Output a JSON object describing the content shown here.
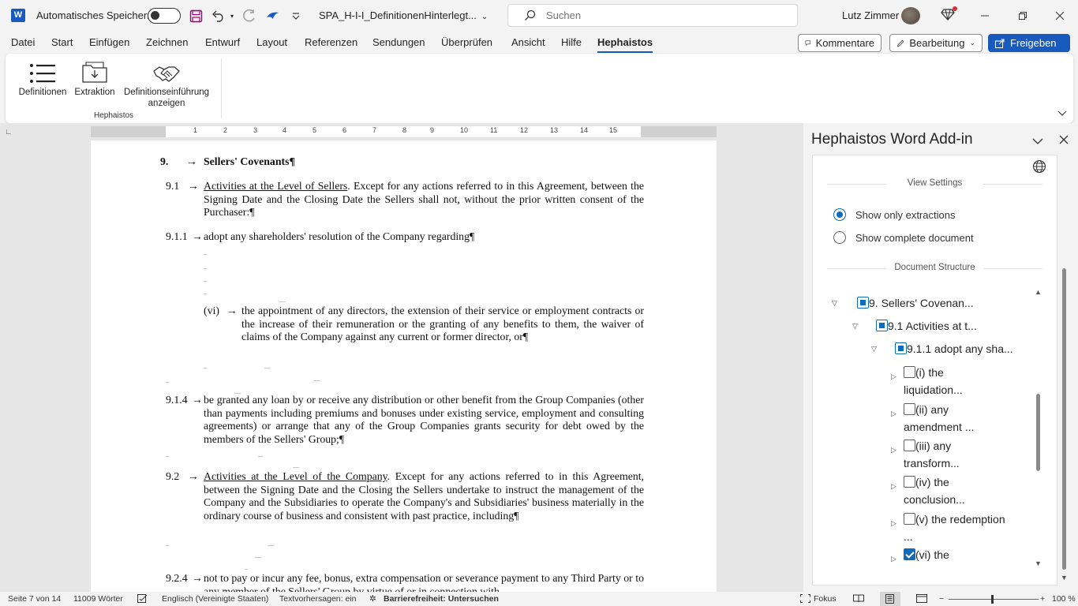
{
  "titlebar": {
    "autosave_label": "Automatisches Speichern",
    "doc_title": "SPA_H-I-I_DefinitionenHinterlegt...",
    "search_placeholder": "Suchen",
    "user_name": "Lutz Zimmer"
  },
  "menu": {
    "items": [
      "Datei",
      "Start",
      "Einfügen",
      "Zeichnen",
      "Entwurf",
      "Layout",
      "Referenzen",
      "Sendungen",
      "Überprüfen",
      "Ansicht",
      "Hilfe",
      "Hephaistos"
    ],
    "active": "Hephaistos",
    "comments_label": "Kommentare",
    "editing_label": "Bearbeitung",
    "share_label": "Freigeben"
  },
  "ribbon": {
    "buttons": [
      "Definitionen",
      "Extraktion",
      "Definitionseinführung anzeigen"
    ],
    "group_label": "Hephaistos"
  },
  "ruler": {
    "ticks": [
      "1",
      "2",
      "3",
      "4",
      "5",
      "6",
      "7",
      "8",
      "9",
      "10",
      "11",
      "12",
      "13",
      "14",
      "15"
    ]
  },
  "document": {
    "s9_num": "9.",
    "s9_title": "Sellers' Covenants¶",
    "s91_num": "9.1",
    "s91_heading": "Activities at the Level of Sellers",
    "s91_text": ". Except for any actions referred to in this Agreement, between the Signing Date and the Closing Date the Sellers shall not, without the prior written consent of the Purchaser:¶",
    "s911_num": "9.1.1",
    "s911_text": "adopt any shareholders' resolution of the Company regarding¶",
    "vi_num": "(vi)",
    "vi_text": "the appointment of any directors, the extension of their service or employment contracts or the increase of their remuneration or the granting of any benefits to them, the waiver of claims of the Company against any current or former director, or¶",
    "s914_num": "9.1.4",
    "s914_text": "be granted any loan by or receive any distribution or other benefit from the Group Companies (other than payments including premiums and bonuses under existing service, employment and consulting agreements) or arrange that any of the Group Companies grants security for debt owed by the members of the Sellers' Group;¶",
    "s92_num": "9.2",
    "s92_heading": "Activities at the Level of the Company",
    "s92_text": ". Except for any actions referred to in this Agreement, between the Signing Date and the Closing the Sellers undertake to instruct the management of the Company and the Subsidiaries to operate the Company's and Subsidiaries' business materially in the ordinary course of business and consistent with past practice, including¶",
    "s924_num": "9.2.4",
    "s924_text": "not to pay or incur any fee, bonus, extra compensation or severance payment to any Third Party or to any member of the Sellers' Group by virtue of or in connection with"
  },
  "pane": {
    "title": "Hephaistos Word Add-in",
    "view_settings": "View Settings",
    "radio_extractions": "Show only extractions",
    "radio_complete": "Show complete document",
    "doc_structure": "Document Structure",
    "tree": {
      "n9": "9. Sellers' Covenan...",
      "n91": "9.1 Activities at t...",
      "n911": "9.1.1 adopt any sha...",
      "i_a": "(i) the",
      "i_b": "liquidation...",
      "ii_a": "(ii) any",
      "ii_b": "amendment ...",
      "iii_a": "(iii) any",
      "iii_b": "transform...",
      "iv_a": "(iv) the",
      "iv_b": "conclusion...",
      "v_a": "(v) the redemption",
      "v_b": "...",
      "vi_a": "(vi) the"
    }
  },
  "status": {
    "page": "Seite 7 von 14",
    "words": "11009 Wörter",
    "language": "Englisch (Vereinigte Staaten)",
    "predictions": "Textvorhersagen: ein",
    "accessibility": "Barrierefreiheit: Untersuchen",
    "focus": "Fokus",
    "zoom": "100 %"
  }
}
